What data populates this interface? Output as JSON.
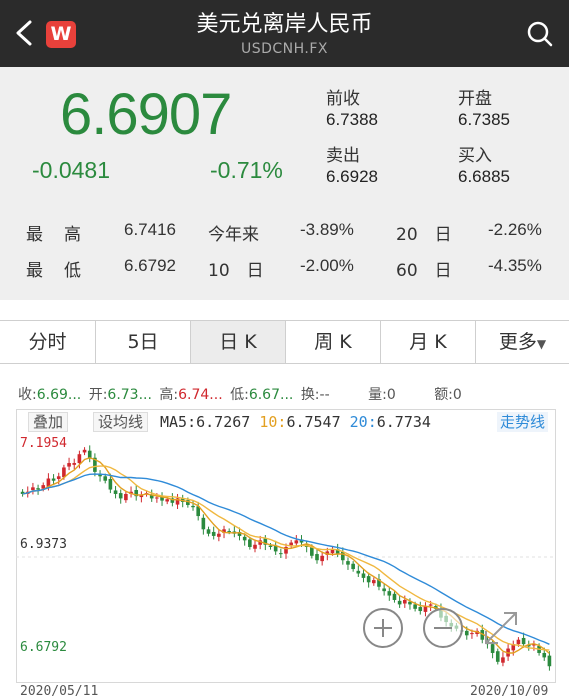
{
  "header": {
    "title": "美元兑离岸人民币",
    "subtitle": "USDCNH.FX",
    "logo": "W",
    "colors": {
      "background": "#2b2b2b",
      "logo": "#e8413b"
    }
  },
  "quote": {
    "price": "6.6907",
    "change": "-0.0481",
    "change_pct": "-0.71%",
    "prev_close_label": "前收",
    "prev_close": "6.7388",
    "open_label": "开盘",
    "open": "6.7385",
    "sell_label": "卖出",
    "sell": "6.6928",
    "buy_label": "买入",
    "buy": "6.6885",
    "stats": [
      {
        "label1": "最",
        "label2": "高",
        "value": "6.7416"
      },
      {
        "label1": "最",
        "label2": "低",
        "value": "6.6792"
      }
    ],
    "period_stats": [
      {
        "label": "今年来",
        "value": "-3.89%"
      },
      {
        "label": "20　日",
        "value": "-2.26%"
      },
      {
        "label": "10　日",
        "value": "-2.00%"
      },
      {
        "label": "60　日",
        "value": "-4.35%"
      }
    ]
  },
  "tabs": [
    {
      "label": "分时",
      "active": false
    },
    {
      "label": "5日",
      "active": false
    },
    {
      "label": "日 K",
      "active": true
    },
    {
      "label": "周 K",
      "active": false
    },
    {
      "label": "月 K",
      "active": false
    },
    {
      "label": "更多",
      "active": false
    }
  ],
  "info": {
    "close_label": "收:",
    "close": "6.69...",
    "open_label": "开:",
    "open": "6.73...",
    "high_label": "高:",
    "high": "6.74...",
    "low_label": "低:",
    "low": "6.67...",
    "turnover_label": "换:",
    "turnover": "--",
    "volume_label": "量:",
    "volume": "0",
    "amount_label": "额:",
    "amount": "0"
  },
  "chart_controls": {
    "overlay": "叠加",
    "ma_settings": "设均线",
    "ma5_label": "MA5:",
    "ma5": "6.7267",
    "ma10_label": "10:",
    "ma10": "6.7547",
    "ma20_label": "20:",
    "ma20": "6.7734",
    "trend": "走势线"
  },
  "chart_data": {
    "type": "candlestick",
    "y_max_label": "7.1954",
    "y_mid_label": "6.9373",
    "y_min_label": "6.6792",
    "ylim": [
      6.6792,
      7.1954
    ],
    "start_date": "2020/05/11",
    "end_date": "2020/10/09",
    "close": [
      7.08,
      7.085,
      7.095,
      7.09,
      7.1,
      7.115,
      7.11,
      7.12,
      7.14,
      7.15,
      7.15,
      7.17,
      7.18,
      7.16,
      7.13,
      7.12,
      7.11,
      7.09,
      7.08,
      7.07,
      7.08,
      7.085,
      7.075,
      7.078,
      7.082,
      7.07,
      7.072,
      7.065,
      7.068,
      7.06,
      7.07,
      7.062,
      7.055,
      7.05,
      7.03,
      7.0,
      6.99,
      6.985,
      6.99,
      7.0,
      6.995,
      6.99,
      6.985,
      6.975,
      6.96,
      6.965,
      6.975,
      6.965,
      6.96,
      6.95,
      6.945,
      6.96,
      6.97,
      6.975,
      6.97,
      6.96,
      6.94,
      6.93,
      6.94,
      6.95,
      6.955,
      6.945,
      6.93,
      6.92,
      6.91,
      6.9,
      6.89,
      6.88,
      6.885,
      6.87,
      6.86,
      6.85,
      6.84,
      6.83,
      6.84,
      6.83,
      6.82,
      6.815,
      6.825,
      6.83,
      6.82,
      6.8,
      6.79,
      6.78,
      6.775,
      6.77,
      6.76,
      6.765,
      6.77,
      6.75,
      6.74,
      6.72,
      6.7,
      6.71,
      6.73,
      6.74,
      6.75,
      6.74,
      6.735,
      6.74,
      6.72,
      6.71,
      6.69
    ],
    "ma5_color": "#e3a021",
    "ma10_color": "#e3a021",
    "ma20_color": "#2f8bd8",
    "up_color": "#d0282e",
    "down_color": "#2b8a3e"
  }
}
